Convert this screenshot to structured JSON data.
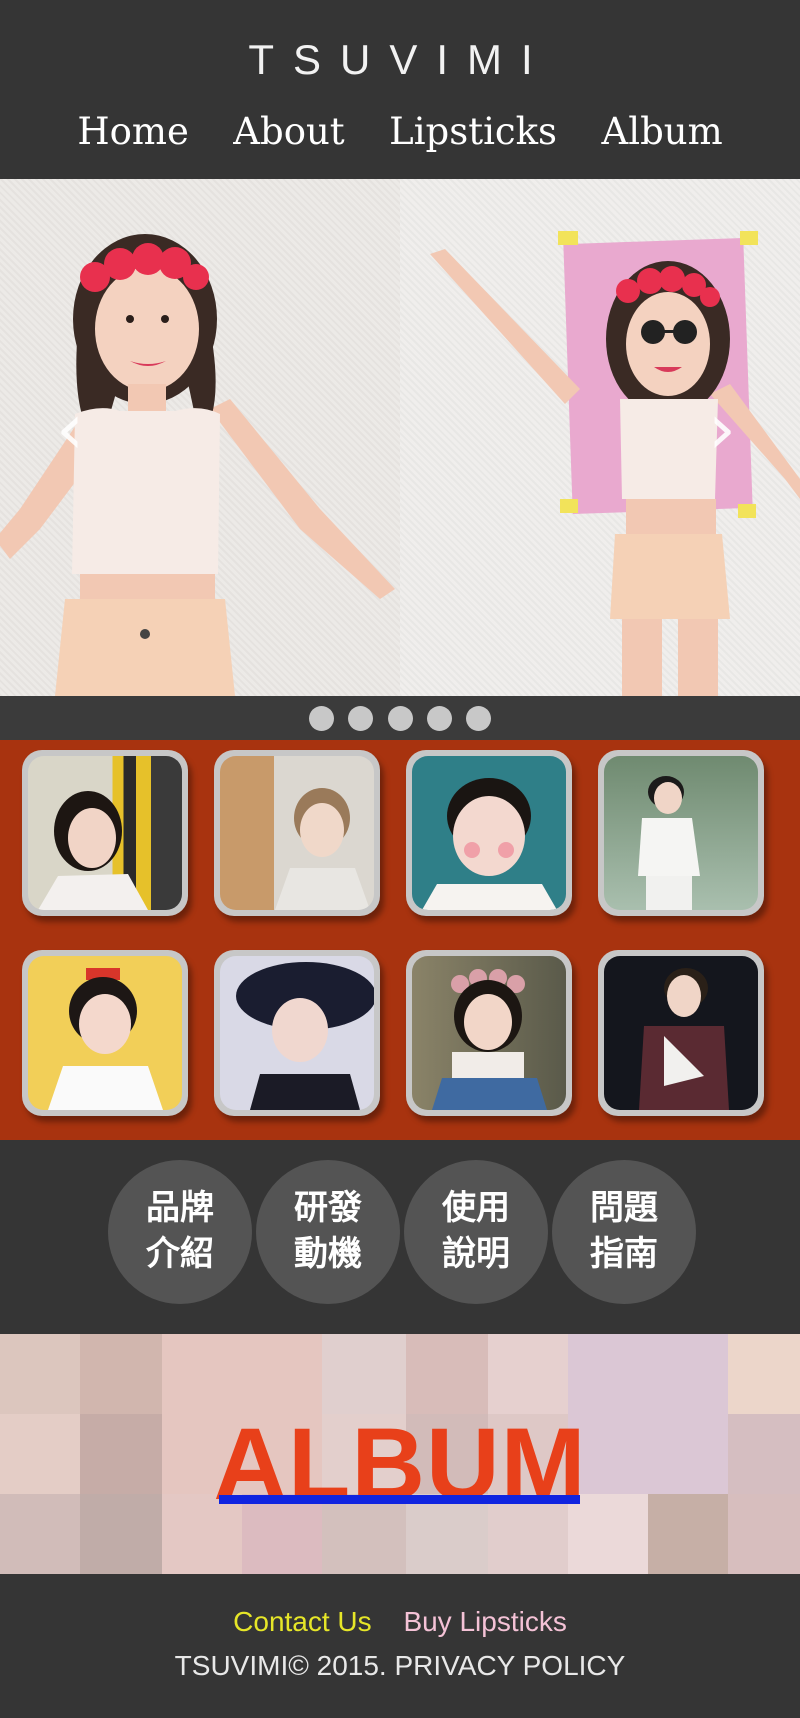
{
  "header": {
    "logo": "TSUVIMI",
    "nav": [
      "Home",
      "About",
      "Lipsticks",
      "Album"
    ]
  },
  "slider": {
    "prev_symbol": "‹",
    "next_symbol": "›",
    "dots_count": 5
  },
  "info_buttons": [
    {
      "line1": "品牌",
      "line2": "介紹"
    },
    {
      "line1": "研發",
      "line2": "動機"
    },
    {
      "line1": "使用",
      "line2": "說明"
    },
    {
      "line1": "問題",
      "line2": "指南"
    }
  ],
  "album": {
    "title": "ALBUM"
  },
  "footer": {
    "contact": "Contact Us",
    "buy": "Buy Lipsticks",
    "copyright": "TSUVIMI© 2015. PRIVACY POLICY"
  },
  "colors": {
    "grid_bg": "#a8330f",
    "album_title": "#e8401a",
    "album_underline": "#1024e0",
    "contact_link": "#e6e628",
    "buy_link": "#f4c2d6"
  }
}
